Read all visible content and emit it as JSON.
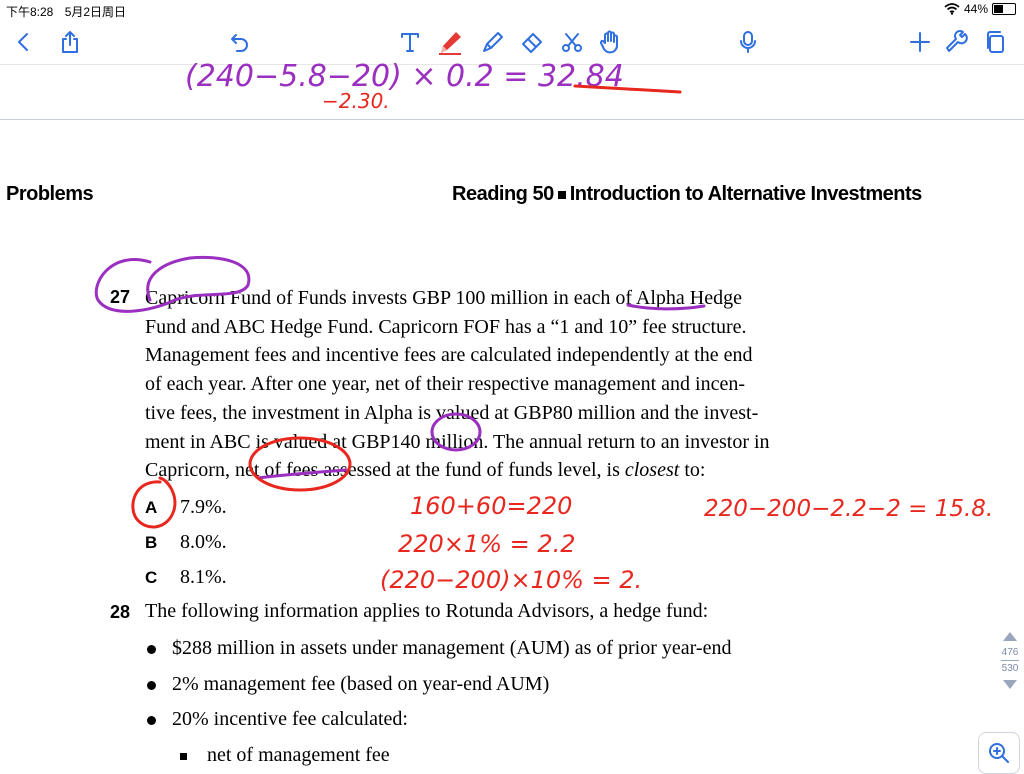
{
  "status": {
    "time": "下午8:28",
    "date": "5月2日周日",
    "battery": "44%"
  },
  "toolbar": {
    "icons": [
      "back-icon",
      "share-icon",
      "undo-icon",
      "text-icon",
      "pen-icon",
      "highlighter-icon",
      "eraser-icon",
      "lasso-icon",
      "hand-icon",
      "mic-icon",
      "add-icon",
      "wrench-icon",
      "pages-icon"
    ],
    "pen_color": "#e53935",
    "accent": "#2f6fe0"
  },
  "header": {
    "left": "Problems",
    "right_prefix": "Reading 50",
    "right_suffix": "Introduction to Alternative Investments"
  },
  "q27": {
    "num": "27",
    "lines": [
      "Capricorn Fund of Funds invests GBP 100 million in each of Alpha Hedge",
      "Fund and ABC Hedge Fund. Capricorn FOF has a “1 and 10” fee structure.",
      "Management fees and incentive fees are calculated independently at the end",
      "of each year. After one year, net of their respective management and incen-",
      "tive fees, the investment in Alpha is valued at GBP80 million and the invest-",
      "ment in ABC is valued at GBP140 million. The annual return to an investor in"
    ],
    "last_line_pre": "Capricorn, net of fees assessed at the fund of funds level, is ",
    "last_line_em": "closest",
    "last_line_post": " to:",
    "options": [
      {
        "letter": "A",
        "text": "7.9%."
      },
      {
        "letter": "B",
        "text": "8.0%."
      },
      {
        "letter": "C",
        "text": "8.1%."
      }
    ]
  },
  "q28": {
    "num": "28",
    "text": "The following information applies to Rotunda Advisors, a hedge fund:",
    "bullets": [
      "$288 million in assets under management (AUM) as of prior year-end",
      "2% management fee (based on year-end AUM)",
      "20% incentive fee calculated:"
    ],
    "subbullets": [
      "net of management fee"
    ]
  },
  "handwriting": {
    "top": "(240−5.8−20) × 0.2 = 32.84",
    "top_sub": "−2.30.",
    "calc1": "160+60=220",
    "calc2": "220×1% = 2.2",
    "calc3": "(220−200)×10% = 2.",
    "calc4": "220−200−2.2−2 = 15.8.",
    "purple": "#9b2fc0",
    "red": "#e8281f"
  },
  "pager": {
    "current": "476",
    "total": "530"
  }
}
